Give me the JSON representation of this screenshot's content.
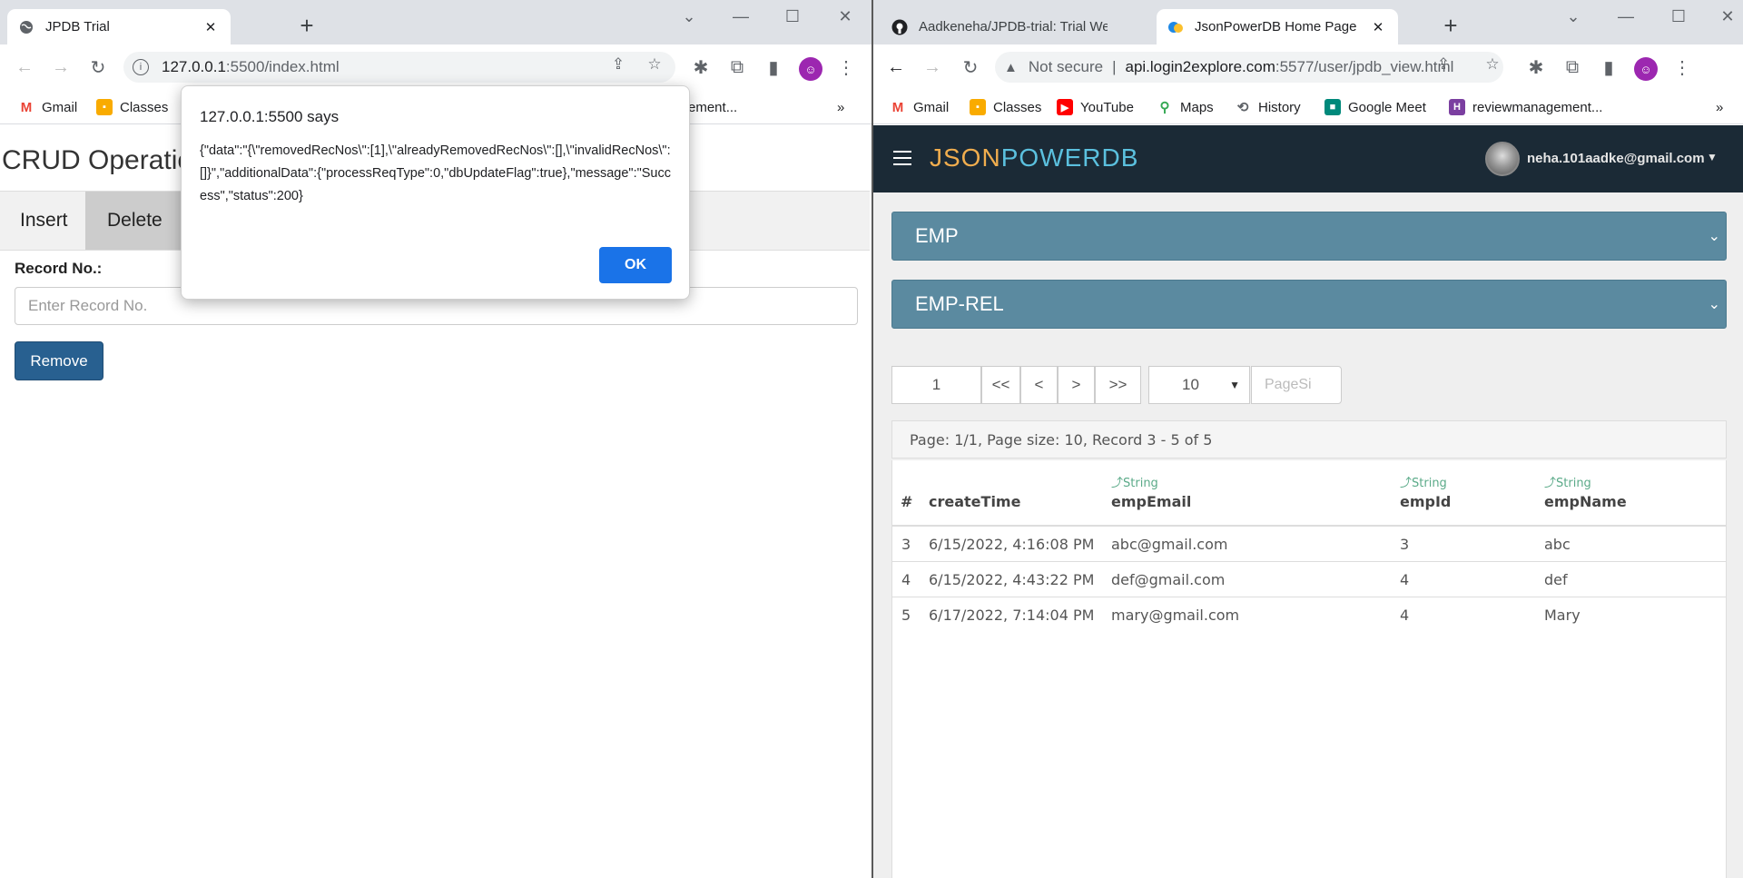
{
  "left_window": {
    "tab": {
      "title": "JPDB Trial"
    },
    "url": {
      "host": "127.0.0.1",
      "rest": ":5500/index.html"
    },
    "bookmarks": [
      {
        "label": "Gmail"
      },
      {
        "label": "Classes"
      },
      {
        "label": "ement..."
      }
    ],
    "page": {
      "title": "CRUD Operatio",
      "tabs": [
        "Insert",
        "Delete"
      ],
      "record_label": "Record No.:",
      "record_placeholder": "Enter Record No.",
      "remove_label": "Remove"
    },
    "dialog": {
      "title": "127.0.0.1:5500 says",
      "message": "{\"data\":\"{\\\"removedRecNos\\\":[1],\\\"alreadyRemovedRecNos\\\":[],\\\"invalidRecNos\\\":[]}\",\"additionalData\":{\"processReqType\":0,\"dbUpdateFlag\":true},\"message\":\"Success\",\"status\":200}",
      "ok_label": "OK"
    }
  },
  "right_window": {
    "tabs": [
      {
        "title": "Aadkeneha/JPDB-trial: Trial Websi"
      },
      {
        "title": "JsonPowerDB Home Page"
      }
    ],
    "url": {
      "security": "Not secure",
      "host": "api.login2explore.com",
      "rest": ":5577/user/jpdb_view.html"
    },
    "bookmarks": [
      {
        "label": "Gmail"
      },
      {
        "label": "Classes"
      },
      {
        "label": "YouTube"
      },
      {
        "label": "Maps"
      },
      {
        "label": "History"
      },
      {
        "label": "Google Meet"
      },
      {
        "label": "reviewmanagement..."
      }
    ],
    "header": {
      "brand_part1": "JSON",
      "brand_part2": "POWERDB",
      "user_email": "neha.101aadke@gmail.com"
    },
    "panels": [
      "EMP",
      "EMP-REL"
    ],
    "pager": {
      "page": "1",
      "first": "<<",
      "prev": "<",
      "next": ">",
      "last": ">>",
      "page_size": "10",
      "page_size_placeholder": "PageSi"
    },
    "info": "Page: 1/1, Page size: 10, Record 3 - 5 of 5",
    "table": {
      "columns": [
        {
          "type": "",
          "name": "#"
        },
        {
          "type": "",
          "name": "createTime"
        },
        {
          "type": "String",
          "name": "empEmail"
        },
        {
          "type": "String",
          "name": "empId"
        },
        {
          "type": "String",
          "name": "empName"
        }
      ],
      "rows": [
        [
          "3",
          "6/15/2022, 4:16:08 PM",
          "abc@gmail.com",
          "3",
          "abc"
        ],
        [
          "4",
          "6/15/2022, 4:43:22 PM",
          "def@gmail.com",
          "4",
          "def"
        ],
        [
          "5",
          "6/17/2022, 7:14:04 PM",
          "mary@gmail.com",
          "4",
          "Mary"
        ]
      ]
    }
  },
  "colors": {
    "header_bg": "#1b2a36",
    "panel_bg": "#5b8aa0",
    "brand_orange": "#f0ad4e",
    "brand_blue": "#5bc0de",
    "remove_button": "#286090",
    "dialog_ok": "#1a73e8"
  }
}
